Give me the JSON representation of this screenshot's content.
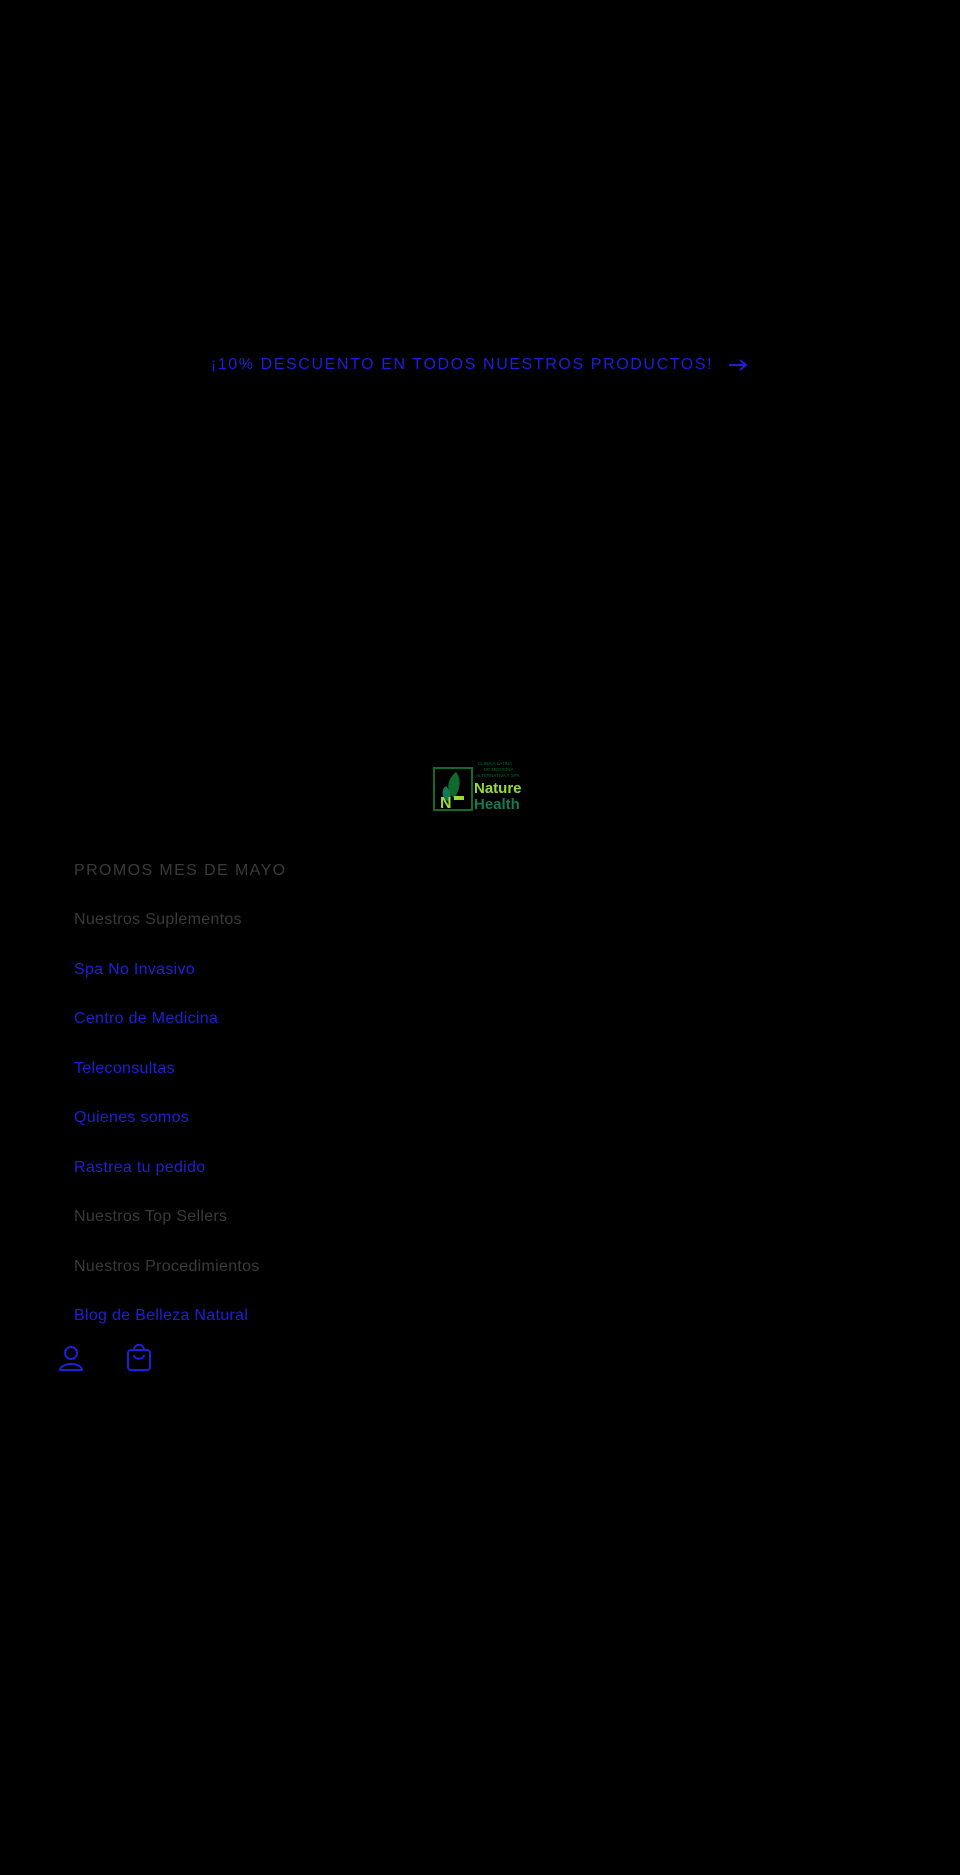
{
  "announcement": {
    "text": "¡10% DESCUENTO EN TODOS NUESTROS PRODUCTOS!",
    "arrow_icon": "arrow-right-icon"
  },
  "logo": {
    "alt": "Nature Health",
    "tagline_lines": [
      "CLÍNICA LATINA",
      "DE MEDICINA",
      "ALTERNATIVA Y SPA"
    ],
    "brand_top": "Nature",
    "brand_bottom": "Health",
    "colors": {
      "green_dark": "#0f6b2c",
      "green_light": "#9ad93a",
      "teal": "#127a55"
    }
  },
  "nav": {
    "items": [
      {
        "label": "PROMOS MES DE MAYO",
        "style": "heading"
      },
      {
        "label": "Nuestros Suplementos",
        "style": "dim"
      },
      {
        "label": "Spa No Invasivo",
        "style": "link"
      },
      {
        "label": "Centro de Medicina",
        "style": "link"
      },
      {
        "label": "Teleconsultas",
        "style": "link"
      },
      {
        "label": "Quienes somos",
        "style": "link"
      },
      {
        "label": "Rastrea tu pedido",
        "style": "link"
      },
      {
        "label": "Nuestros Top Sellers",
        "style": "dim"
      },
      {
        "label": "Nuestros Procedimientos",
        "style": "dim"
      },
      {
        "label": "Blog de Belleza Natural",
        "style": "link"
      }
    ]
  },
  "header_icons": {
    "account_icon": "account-icon",
    "cart_icon": "cart-icon"
  },
  "colors": {
    "background": "#000000",
    "accent": "#1f1fd9",
    "dim_text": "#3a3a3a"
  }
}
